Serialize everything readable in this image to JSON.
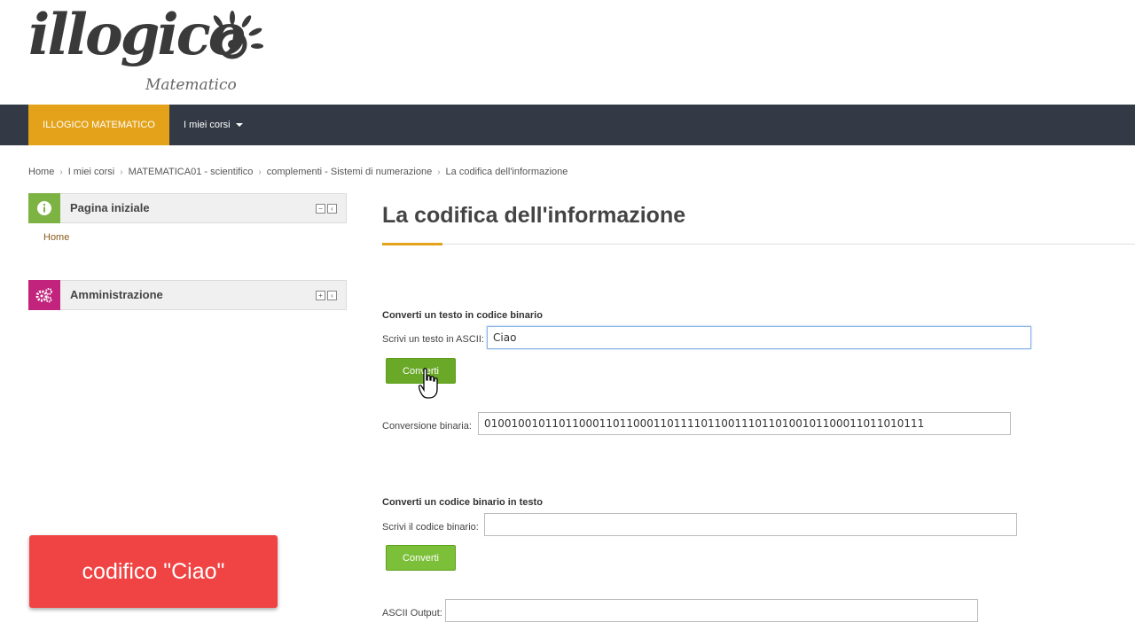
{
  "logo": {
    "main": "illogico",
    "sub": "Matematico"
  },
  "navbar": {
    "brand": "ILLOGICO MATEMATICO",
    "courses": "I miei corsi"
  },
  "breadcrumb": [
    "Home",
    "I miei corsi",
    "MATEMATICA01 - scientifico",
    "complementi - Sistemi di numerazione",
    "La codifica dell'informazione"
  ],
  "sidebar": {
    "block1": {
      "title": "Pagina iniziale",
      "icon": "info-icon",
      "color": "#7cb342",
      "link": "Home"
    },
    "block2": {
      "title": "Amministrazione",
      "icon": "gears-icon",
      "color": "#c2247d"
    }
  },
  "main": {
    "title": "La codifica dell'informazione",
    "section1": {
      "heading": "Converti un testo in codice binario",
      "input_label": "Scrivi un testo in ASCII:",
      "input_value": "Ciao",
      "button": "Converti",
      "output_label": "Conversione binaria:",
      "output_value": "01001001011011000110110001101111011001110110100101100011011010111"
    },
    "section2": {
      "heading": "Converti un codice binario in testo",
      "input_label": "Scrivi il codice binario:",
      "input_value": "",
      "button": "Converti",
      "output_label": "ASCII Output:",
      "output_value": ""
    }
  },
  "overlay": {
    "text": "codifico \"Ciao\""
  },
  "colors": {
    "navbar": "#333a45",
    "accent": "#e3a21a",
    "button": "#6aa828",
    "overlay": "#f04343"
  }
}
